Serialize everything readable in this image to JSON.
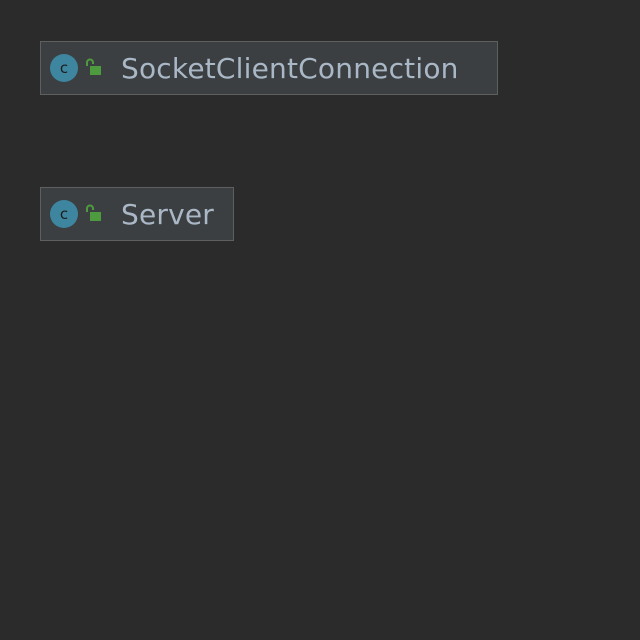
{
  "colors": {
    "background": "#2b2b2b",
    "node_fill": "#3c3f41",
    "node_border": "#5e6060",
    "class_icon": "#3e86a0",
    "public_icon": "#4e9a3e",
    "text": "#a9b7c6"
  },
  "nodes": [
    {
      "icon": "class-icon",
      "icon_letter": "c",
      "visibility_icon": "unlocked-public-icon",
      "name": "SocketClientConnection"
    },
    {
      "icon": "class-icon",
      "icon_letter": "c",
      "visibility_icon": "unlocked-public-icon",
      "name": "Server"
    }
  ]
}
